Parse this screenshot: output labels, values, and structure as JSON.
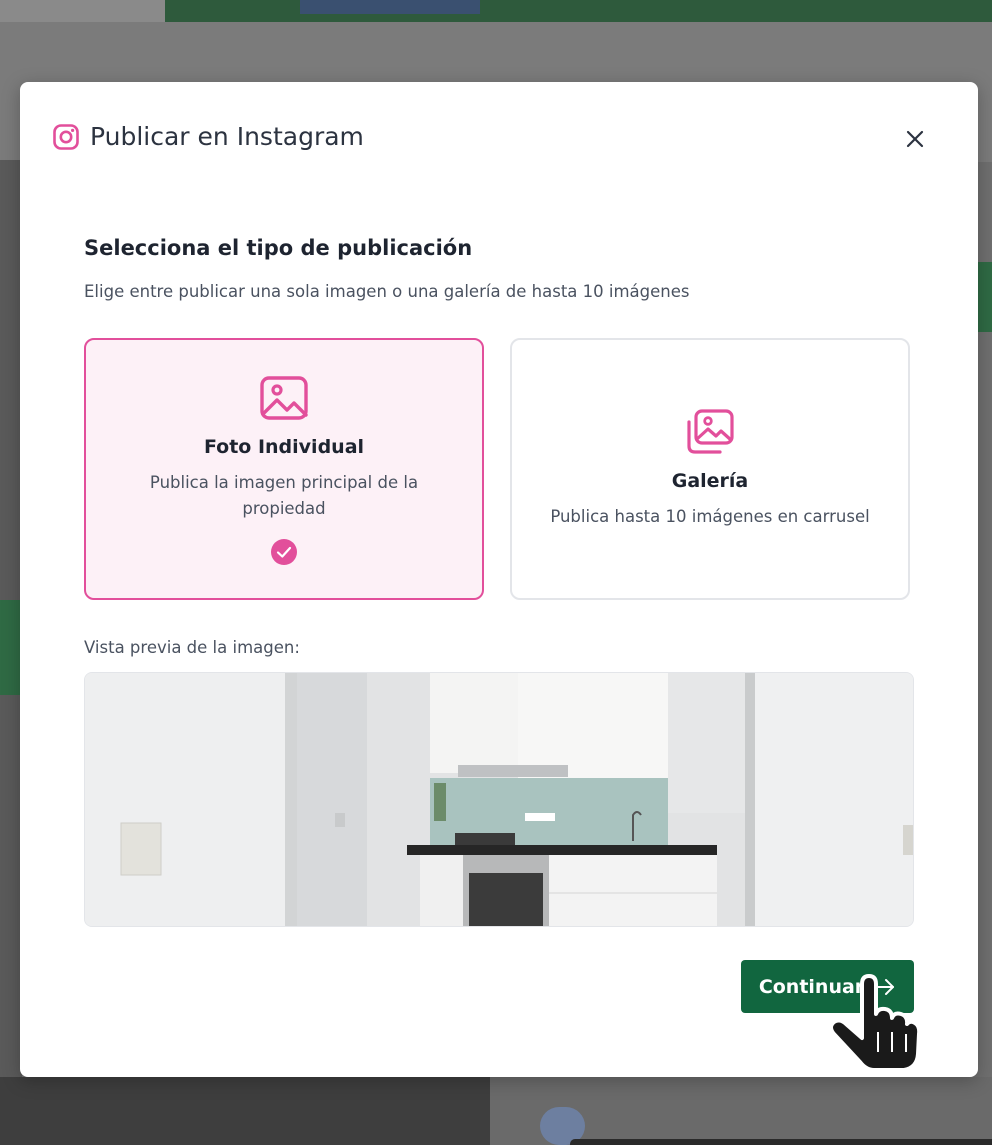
{
  "modal": {
    "title": "Publicar en Instagram",
    "section_title": "Selecciona el tipo de publicación",
    "section_subtitle": "Elige entre publicar una sola imagen o una galería de hasta 10 imágenes",
    "options": [
      {
        "title": "Foto Individual",
        "description": "Publica la imagen principal de la propiedad",
        "icon": "image-icon",
        "selected": true
      },
      {
        "title": "Galería",
        "description": "Publica hasta 10 imágenes en carrusel",
        "icon": "images-icon",
        "selected": false
      }
    ],
    "preview_label": "Vista previa de la imagen:",
    "continue_label": "Continuar"
  },
  "colors": {
    "accent_pink": "#e24f9b",
    "primary_green": "#11663f",
    "selected_bg": "#fdf1f7"
  }
}
